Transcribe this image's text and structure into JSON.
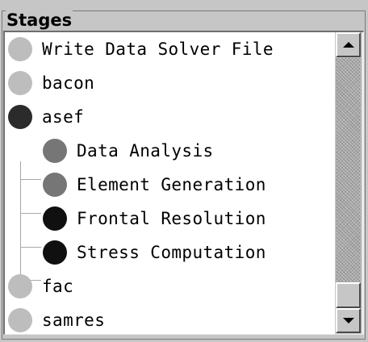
{
  "group": {
    "title": "Stages"
  },
  "stages": [
    {
      "label": "Write Data Solver File",
      "color": "#bdbdbd",
      "level": 0
    },
    {
      "label": "bacon",
      "color": "#bdbdbd",
      "level": 0
    },
    {
      "label": "asef",
      "color": "#2b2b2b",
      "level": 0
    },
    {
      "label": "Data Analysis",
      "color": "#767676",
      "level": 1
    },
    {
      "label": "Element Generation",
      "color": "#767676",
      "level": 1
    },
    {
      "label": "Frontal Resolution",
      "color": "#101010",
      "level": 1
    },
    {
      "label": "Stress Computation",
      "color": "#101010",
      "level": 1
    },
    {
      "label": "fac",
      "color": "#bdbdbd",
      "level": 0
    },
    {
      "label": "samres",
      "color": "#bdbdbd",
      "level": 0
    }
  ],
  "scrollbar": {
    "up_icon": "arrow-up-icon",
    "down_icon": "arrow-down-icon",
    "thumb_position_fraction": 0.92
  }
}
